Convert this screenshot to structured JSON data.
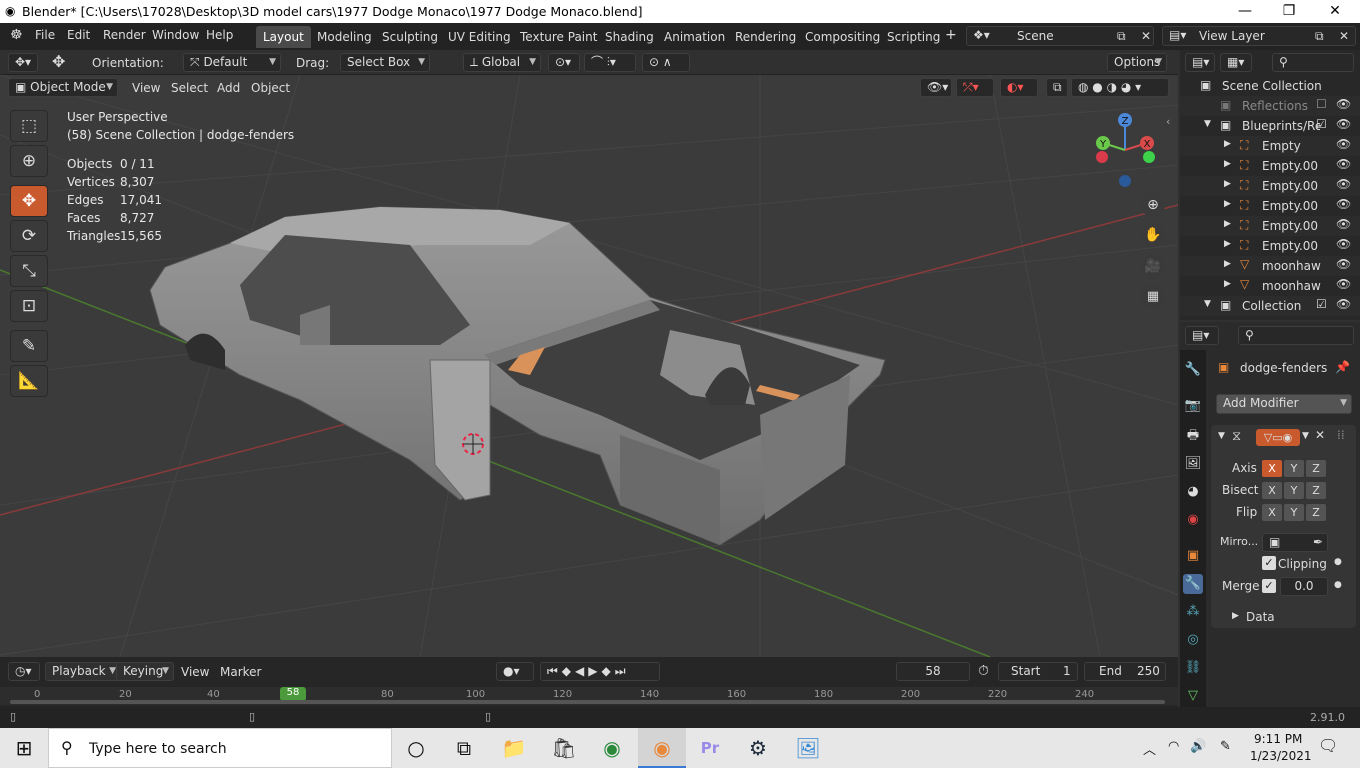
{
  "titlebar": {
    "title": "Blender* [C:\\Users\\17028\\Desktop\\3D model cars\\1977 Dodge Monaco\\1977 Dodge Monaco.blend]",
    "minimize": "—",
    "maximize": "❐",
    "close": "✕"
  },
  "menus": [
    "File",
    "Edit",
    "Render",
    "Window",
    "Help"
  ],
  "workspaces": [
    "Layout",
    "Modeling",
    "Sculpting",
    "UV Editing",
    "Texture Paint",
    "Shading",
    "Animation",
    "Rendering",
    "Compositing",
    "Scripting"
  ],
  "add_workspace": "+",
  "scene": "Scene",
  "view_layer": "View Layer",
  "header": {
    "orientation_label": "Orientation:",
    "orientation": "Default",
    "drag_label": "Drag:",
    "drag": "Select Box",
    "transform": "Global",
    "options": "Options"
  },
  "viewport_header": {
    "mode": "Object Mode",
    "menus": [
      "View",
      "Select",
      "Add",
      "Object"
    ]
  },
  "viewport": {
    "view_name": "User Perspective",
    "collection_info": "(58) Scene Collection | dodge-fenders",
    "stats": [
      {
        "label": "Objects",
        "value": "0 / 11"
      },
      {
        "label": "Vertices",
        "value": "8,307"
      },
      {
        "label": "Edges",
        "value": "17,041"
      },
      {
        "label": "Faces",
        "value": "8,727"
      },
      {
        "label": "Triangles",
        "value": "15,565"
      }
    ],
    "gizmo": {
      "x": "X",
      "y": "Y",
      "z": "Z"
    }
  },
  "outliner": {
    "root": "Scene Collection",
    "items": [
      {
        "name": "Reflections",
        "type": "collection",
        "dim": true
      },
      {
        "name": "Blueprints/Ref",
        "type": "collection",
        "dim": false
      },
      {
        "name": "Empty",
        "type": "empty",
        "dim": false
      },
      {
        "name": "Empty.00",
        "type": "empty",
        "dim": false
      },
      {
        "name": "Empty.00",
        "type": "empty",
        "dim": false
      },
      {
        "name": "Empty.00",
        "type": "empty",
        "dim": false
      },
      {
        "name": "Empty.00",
        "type": "empty",
        "dim": false
      },
      {
        "name": "Empty.00",
        "type": "empty",
        "dim": false
      },
      {
        "name": "moonhaw",
        "type": "mesh",
        "dim": false
      },
      {
        "name": "moonhaw",
        "type": "mesh",
        "dim": false
      },
      {
        "name": "Collection",
        "type": "collection",
        "dim": false
      }
    ]
  },
  "properties": {
    "object_name": "dodge-fenders",
    "add_modifier": "Add Modifier",
    "axis_label": "Axis",
    "bisect_label": "Bisect",
    "flip_label": "Flip",
    "x": "X",
    "y": "Y",
    "z": "Z",
    "mirror_label": "Mirro...",
    "clipping_label": "Clipping",
    "merge_label": "Merge",
    "merge_value": "0.0",
    "data_label": "Data"
  },
  "timeline": {
    "menus": [
      "Playback",
      "Keying",
      "View",
      "Marker"
    ],
    "current_frame": "58",
    "start_label": "Start",
    "start": "1",
    "end_label": "End",
    "end": "250",
    "ruler": [
      "0",
      "20",
      "40",
      "58",
      "80",
      "100",
      "120",
      "140",
      "160",
      "180",
      "200",
      "220",
      "240"
    ]
  },
  "status": {
    "version": "2.91.0"
  },
  "taskbar": {
    "search_placeholder": "Type here to search",
    "time": "9:11 PM",
    "date": "1/23/2021"
  }
}
